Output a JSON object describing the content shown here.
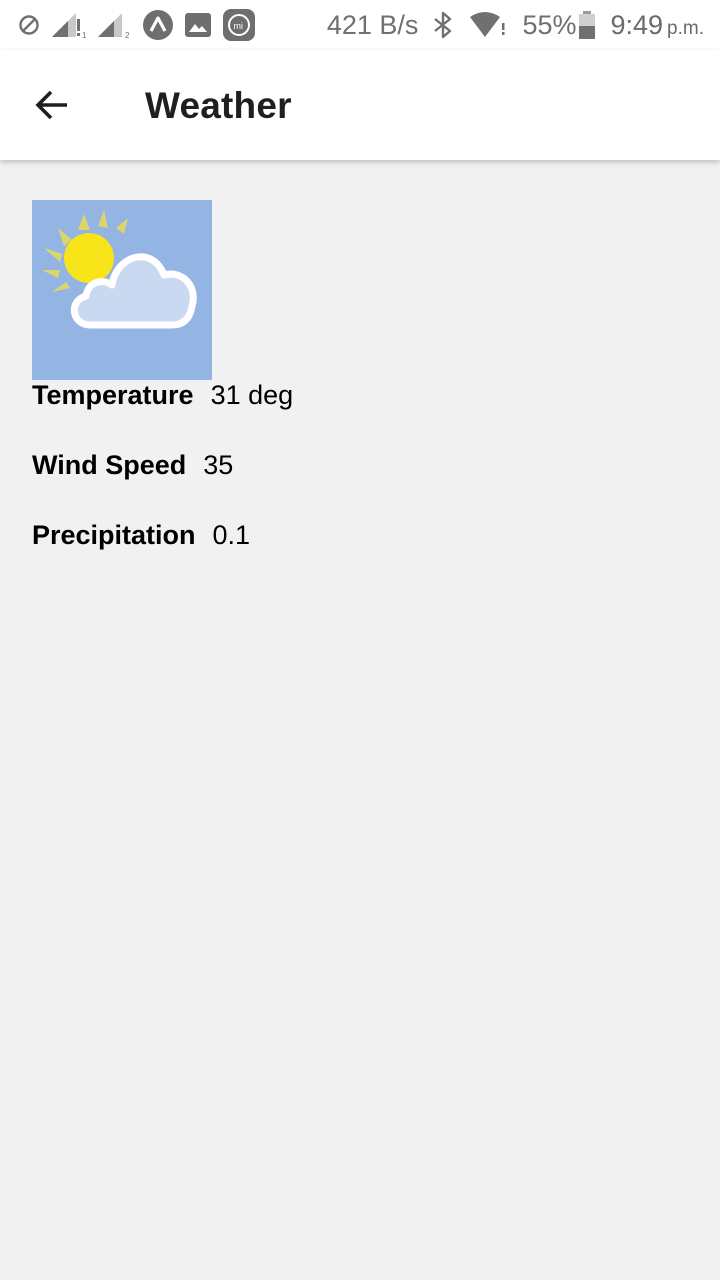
{
  "status_bar": {
    "network_speed": "421 B/s",
    "battery": "55%",
    "time": "9:49",
    "ampm": "p.m.",
    "icons": [
      "do-not-disturb-icon",
      "signal-sim1-icon",
      "signal-sim2-icon",
      "app-logo-icon",
      "gallery-icon",
      "mi-app-icon",
      "bluetooth-icon",
      "wifi-icon",
      "battery-icon"
    ]
  },
  "app_bar": {
    "title": "Weather",
    "back_icon": "arrow-left-icon"
  },
  "weather": {
    "icon": "partly-cloudy-icon",
    "rows": [
      {
        "label": "Temperature",
        "value": "31 deg"
      },
      {
        "label": "Wind Speed",
        "value": "35"
      },
      {
        "label": "Precipitation",
        "value": "0.1"
      }
    ]
  },
  "colors": {
    "background": "#f1f1f1",
    "app_bar": "#ffffff",
    "image_background": "#94b4e4",
    "sun": "#f7e51a"
  }
}
